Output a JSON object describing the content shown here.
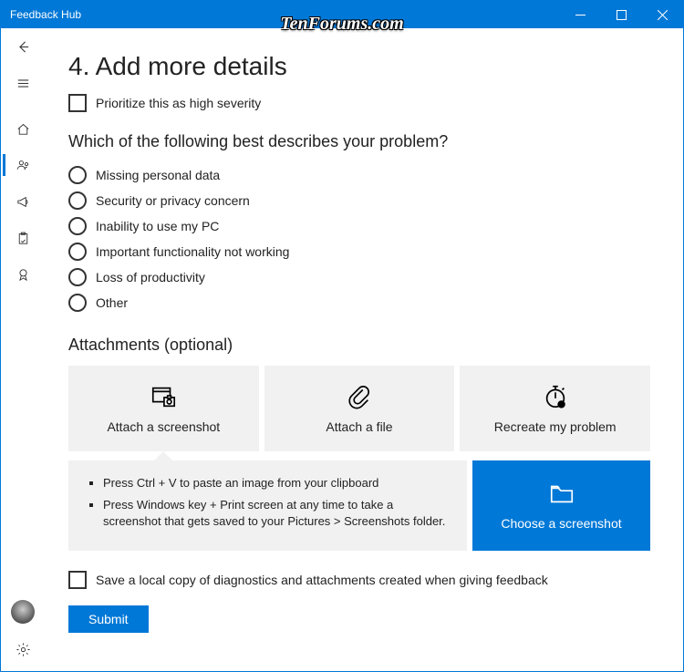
{
  "window": {
    "title": "Feedback Hub"
  },
  "watermark": "TenForums.com",
  "main": {
    "heading": "4. Add more details",
    "severity_checkbox": "Prioritize this as high severity",
    "problem_question": "Which of the following best describes your problem?",
    "problem_options": [
      "Missing personal data",
      "Security or privacy concern",
      "Inability to use my PC",
      "Important functionality not working",
      "Loss of productivity",
      "Other"
    ],
    "attachments_heading": "Attachments (optional)",
    "attach_cards": {
      "screenshot": "Attach a screenshot",
      "file": "Attach a file",
      "recreate": "Recreate my problem"
    },
    "tips": [
      "Press Ctrl + V to paste an image from your clipboard",
      "Press Windows key + Print screen at any time to take a screenshot that gets saved to your Pictures > Screenshots folder."
    ],
    "choose_screenshot": "Choose a screenshot",
    "save_local_checkbox": "Save a local copy of diagnostics and attachments created when giving feedback",
    "submit": "Submit"
  }
}
